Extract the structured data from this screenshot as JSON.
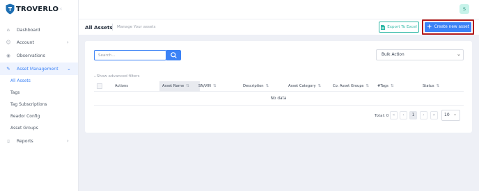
{
  "brand": {
    "name": "TROVERLO"
  },
  "user": {
    "initial": "S"
  },
  "sidebar": {
    "collapse_icon": "chevron-left-icon",
    "items": [
      {
        "label": "Dashboard",
        "icon": "home-icon"
      },
      {
        "label": "Account",
        "icon": "user-icon",
        "has_chevron": true
      },
      {
        "label": "Observations",
        "icon": "eye-icon"
      },
      {
        "label": "Asset Management",
        "icon": "edit-icon",
        "has_chevron": true,
        "expanded": true
      },
      {
        "label": "Reports",
        "icon": "file-icon",
        "has_chevron": true
      }
    ],
    "sub_items": [
      {
        "label": "All Assets",
        "active": true
      },
      {
        "label": "Tags"
      },
      {
        "label": "Tag Subscriptions"
      },
      {
        "label": "Reador Config"
      },
      {
        "label": "Asset Groups"
      }
    ]
  },
  "page": {
    "title": "All Assets",
    "subtitle": "Manage Your assets",
    "export_label": "Export To Excel",
    "create_label": "Create new asset"
  },
  "search": {
    "placeholder": "Search..."
  },
  "bulk_action": {
    "selected": "Bulk Action"
  },
  "advanced_filters": {
    "label": "Show advanced filters"
  },
  "table": {
    "columns": [
      {
        "label": "Actions",
        "sortable": false
      },
      {
        "label": "Asset Name",
        "sortable": true
      },
      {
        "label": "SN/VIN",
        "sortable": true
      },
      {
        "label": "Description",
        "sortable": true
      },
      {
        "label": "Asset Category",
        "sortable": true
      },
      {
        "label": "Co. Asset Groups",
        "sortable": true
      },
      {
        "label": "#Tags",
        "sortable": true
      },
      {
        "label": "Status",
        "sortable": true
      }
    ],
    "empty_text": "No data"
  },
  "pagination": {
    "total_label": "Total: 0",
    "current_page": "1",
    "page_size": "10"
  },
  "colors": {
    "primary": "#3b82f6",
    "teal": "#2fb8a6",
    "highlight": "#b31b1b"
  }
}
